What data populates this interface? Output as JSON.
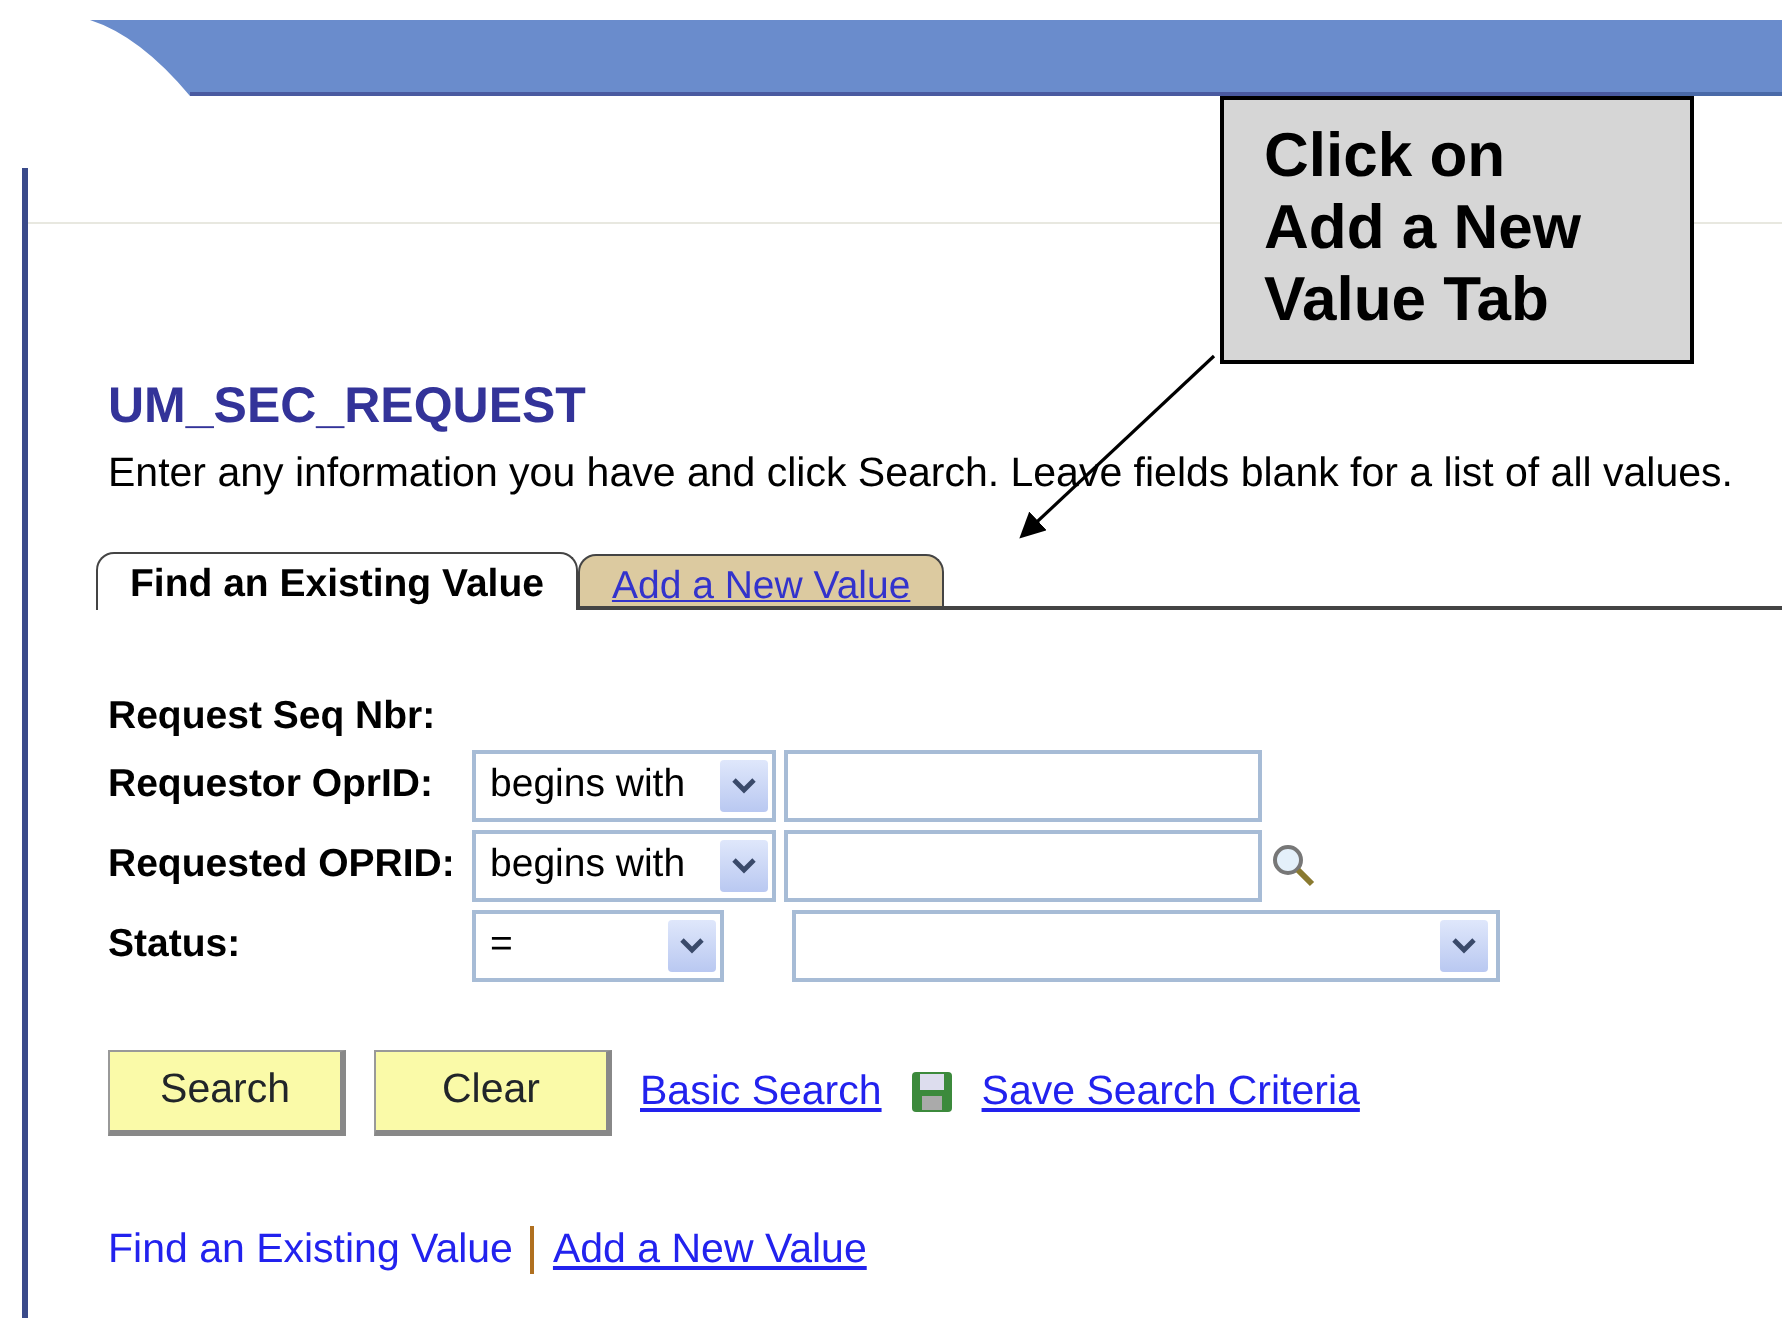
{
  "callout": {
    "lines": [
      "Click on",
      "Add a New",
      "Value Tab"
    ]
  },
  "page": {
    "title": "UM_SEC_REQUEST",
    "instructions": "Enter any information you have and click Search. Leave fields blank for a list of all values."
  },
  "tabs": [
    {
      "label": "Find an Existing Value",
      "selected": true
    },
    {
      "label": "Add a New Value",
      "selected": false
    }
  ],
  "fields": [
    {
      "kind": "label",
      "label": "Request Seq Nbr:"
    },
    {
      "kind": "text",
      "label": "Requestor OprID:",
      "operator": "begins with",
      "lookup": false
    },
    {
      "kind": "text",
      "label": "Requested OPRID:",
      "operator": "begins with",
      "lookup": true
    },
    {
      "kind": "select",
      "label": "Status:",
      "operator": "=",
      "lookup": false
    }
  ],
  "buttons": [
    "Search",
    "Clear"
  ],
  "links": [
    {
      "kind": "plain",
      "text": "Basic Search"
    },
    {
      "kind": "save",
      "text": "Save Search Criteria"
    }
  ],
  "footer_links": [
    {
      "text": "Find an Existing Value",
      "selected": true
    },
    {
      "text": "Add a New Value",
      "selected": false
    }
  ]
}
